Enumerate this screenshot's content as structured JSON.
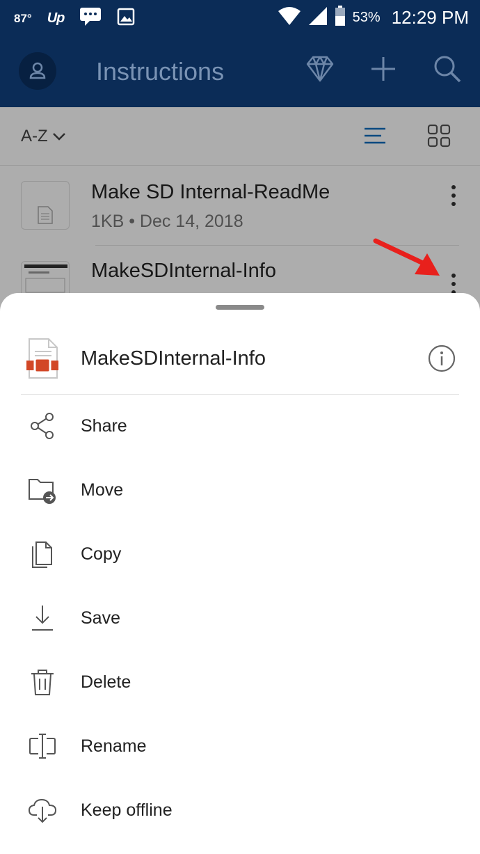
{
  "status_bar": {
    "temperature": "87°",
    "carrier_logo": "Up",
    "battery": "53%",
    "time": "12:29 PM"
  },
  "app_bar": {
    "title": "Instructions"
  },
  "sort": {
    "label": "A-Z"
  },
  "files": [
    {
      "name": "Make SD Internal-ReadMe",
      "meta": "1KB • Dec 14, 2018"
    },
    {
      "name": "MakeSDInternal-Info",
      "meta": ""
    }
  ],
  "sheet": {
    "file_name": "MakeSDInternal-Info",
    "actions": [
      {
        "label": "Share",
        "icon": "share-icon"
      },
      {
        "label": "Move",
        "icon": "move-folder-icon"
      },
      {
        "label": "Copy",
        "icon": "copy-icon"
      },
      {
        "label": "Save",
        "icon": "download-icon"
      },
      {
        "label": "Delete",
        "icon": "trash-icon"
      },
      {
        "label": "Rename",
        "icon": "rename-icon"
      },
      {
        "label": "Keep offline",
        "icon": "cloud-download-icon"
      }
    ]
  },
  "colors": {
    "app_bar": "#0b2c57",
    "accent": "#0f6cbd",
    "arrow": "#e8201c",
    "file_icon": "#d24726"
  }
}
